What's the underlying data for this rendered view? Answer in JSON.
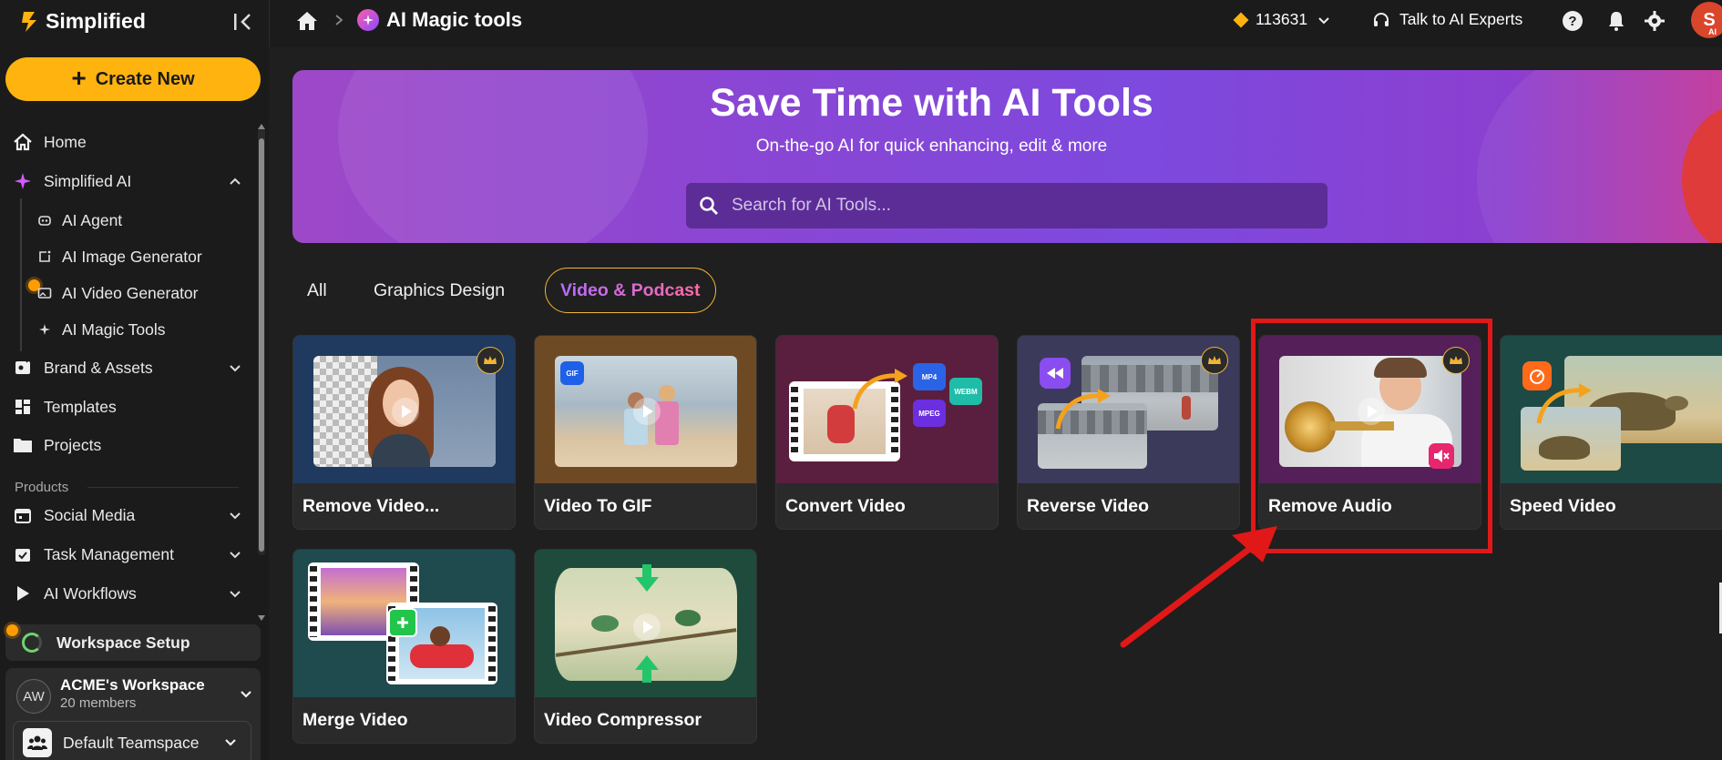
{
  "app": {
    "name": "Simplified"
  },
  "sidebar": {
    "create_label": "Create New",
    "items": [
      {
        "label": "Home"
      },
      {
        "label": "Simplified AI"
      },
      {
        "label": "Brand & Assets"
      },
      {
        "label": "Templates"
      },
      {
        "label": "Projects"
      },
      {
        "label": "Social Media"
      },
      {
        "label": "Task Management"
      },
      {
        "label": "AI Workflows"
      }
    ],
    "ai_subitems": [
      {
        "label": "AI Agent"
      },
      {
        "label": "AI Image Generator"
      },
      {
        "label": "AI Video Generator"
      },
      {
        "label": "AI Magic Tools"
      }
    ],
    "section_products": "Products",
    "workspace_setup": "Workspace Setup",
    "workspace": {
      "initials": "AW",
      "name": "ACME's Workspace",
      "members": "20 members"
    },
    "teamspace": "Default Teamspace"
  },
  "topbar": {
    "breadcrumb_title": "AI Magic tools",
    "credits": "113631",
    "experts_label": "Talk to AI Experts",
    "user_initial": "S",
    "user_tag": "AI"
  },
  "hero": {
    "title": "Save Time with AI Tools",
    "subtitle": "On-the-go AI for quick enhancing, edit & more",
    "search_placeholder": "Search for AI Tools..."
  },
  "tabs": [
    {
      "label": "All"
    },
    {
      "label": "Graphics Design"
    },
    {
      "label": "Video & Podcast",
      "active": true
    }
  ],
  "cards": [
    {
      "label": "Remove Video...",
      "premium": true
    },
    {
      "label": "Video To GIF",
      "badge": "GIF"
    },
    {
      "label": "Convert Video",
      "formats": [
        "MP4",
        "WEBM",
        "MPEG"
      ]
    },
    {
      "label": "Reverse Video",
      "premium": true
    },
    {
      "label": "Remove Audio",
      "premium": true
    },
    {
      "label": "Speed Video"
    },
    {
      "label": "Merge Video"
    },
    {
      "label": "Video Compressor"
    }
  ],
  "colors": {
    "accent": "#ffb30f",
    "highlight": "#e01818",
    "hero_purple": "#8b46d3"
  }
}
